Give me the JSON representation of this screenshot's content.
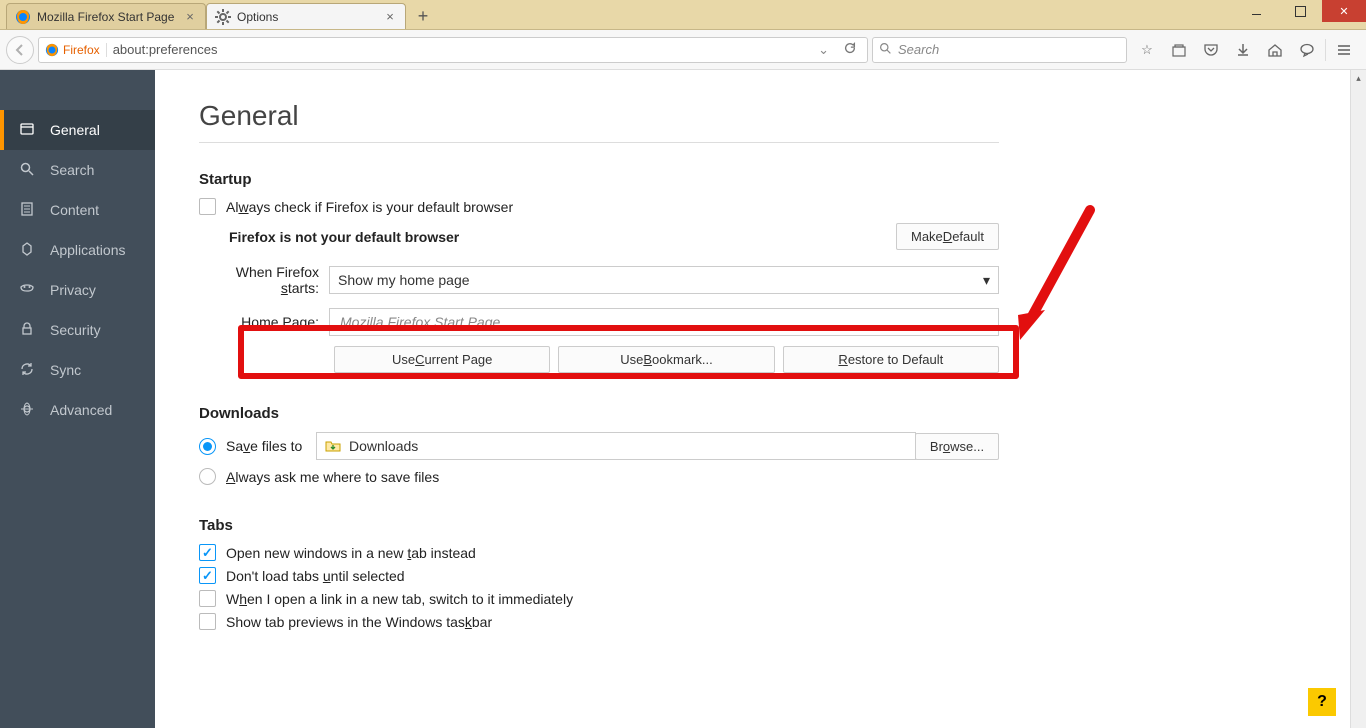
{
  "window": {
    "tabs": [
      {
        "label": "Mozilla Firefox Start Page",
        "active": false
      },
      {
        "label": "Options",
        "active": true
      }
    ]
  },
  "urlbar": {
    "identity": "Firefox",
    "url": "about:preferences"
  },
  "searchbox": {
    "placeholder": "Search"
  },
  "sidebar": {
    "items": [
      {
        "label": "General",
        "icon": "general"
      },
      {
        "label": "Search",
        "icon": "search"
      },
      {
        "label": "Content",
        "icon": "content"
      },
      {
        "label": "Applications",
        "icon": "applications"
      },
      {
        "label": "Privacy",
        "icon": "privacy"
      },
      {
        "label": "Security",
        "icon": "security"
      },
      {
        "label": "Sync",
        "icon": "sync"
      },
      {
        "label": "Advanced",
        "icon": "advanced"
      }
    ],
    "active_index": 0
  },
  "page": {
    "title": "General",
    "startup": {
      "heading": "Startup",
      "always_check_label": "Always check if Firefox is your default browser",
      "always_check_checked": false,
      "default_status": "Firefox is not your default browser",
      "make_default_btn": "Make Default",
      "when_starts_label": "When Firefox starts:",
      "when_starts_value": "Show my home page",
      "home_page_label": "Home Page:",
      "home_page_placeholder": "Mozilla Firefox Start Page",
      "use_current_btn": "Use Current Page",
      "use_bookmark_btn": "Use Bookmark...",
      "restore_default_btn": "Restore to Default"
    },
    "downloads": {
      "heading": "Downloads",
      "save_to_label": "Save files to",
      "save_to_path": "Downloads",
      "browse_btn": "Browse...",
      "always_ask_label": "Always ask me where to save files",
      "selected": "save_to"
    },
    "tabs_section": {
      "heading": "Tabs",
      "open_new_windows": {
        "label": "Open new windows in a new tab instead",
        "checked": true
      },
      "dont_load": {
        "label": "Don't load tabs until selected",
        "checked": true
      },
      "switch_immediately": {
        "label": "When I open a link in a new tab, switch to it immediately",
        "checked": false
      },
      "show_previews": {
        "label": "Show tab previews in the Windows taskbar",
        "checked": false
      }
    }
  },
  "help_btn": "?"
}
